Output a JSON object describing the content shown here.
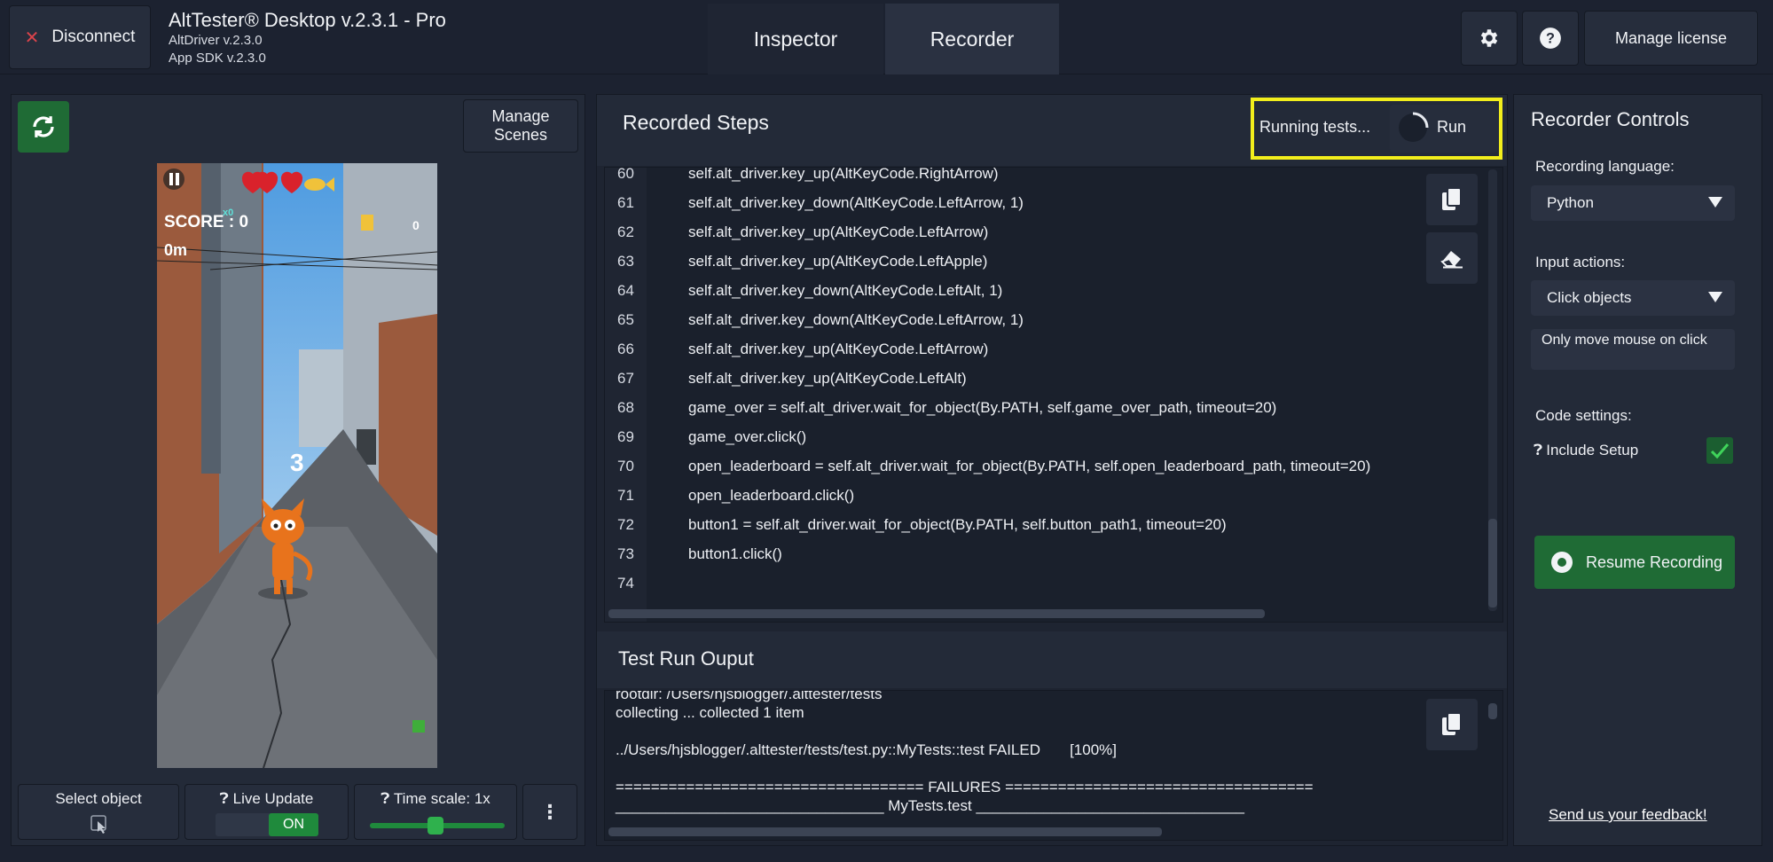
{
  "header": {
    "disconnect_label": "Disconnect",
    "app_title": "AltTester® Desktop v.2.3.1 - Pro",
    "altdriver_version": "AltDriver v.2.3.0",
    "app_sdk_version": "App SDK v.2.3.0",
    "tabs": [
      {
        "label": "Inspector",
        "active": false
      },
      {
        "label": "Recorder",
        "active": true
      }
    ],
    "manage_license_label": "Manage license"
  },
  "left_panel": {
    "manage_scenes_label": "Manage Scenes",
    "game_preview": {
      "score_label": "SCORE : 0",
      "distance_label": "0m",
      "multiplier_label": "x0",
      "countdown": "3",
      "side_count": "0",
      "hearts": 3
    },
    "bottom_controls": {
      "select_object_label": "Select object",
      "live_update_label": "Live Update",
      "live_update_state": "ON",
      "time_scale_label": "Time scale: 1x",
      "time_scale_value": 0.5
    }
  },
  "recorded_steps": {
    "title": "Recorded Steps",
    "running_text": "Running tests...",
    "run_label": "Run",
    "lines": [
      {
        "n": "60",
        "code": "self.alt_driver.key_up(AltKeyCode.RightArrow)"
      },
      {
        "n": "61",
        "code": "self.alt_driver.key_down(AltKeyCode.LeftArrow, 1)"
      },
      {
        "n": "62",
        "code": "self.alt_driver.key_up(AltKeyCode.LeftArrow)"
      },
      {
        "n": "63",
        "code": "self.alt_driver.key_up(AltKeyCode.LeftApple)"
      },
      {
        "n": "64",
        "code": "self.alt_driver.key_down(AltKeyCode.LeftAlt, 1)"
      },
      {
        "n": "65",
        "code": "self.alt_driver.key_down(AltKeyCode.LeftArrow, 1)"
      },
      {
        "n": "66",
        "code": "self.alt_driver.key_up(AltKeyCode.LeftArrow)"
      },
      {
        "n": "67",
        "code": "self.alt_driver.key_up(AltKeyCode.LeftAlt)"
      },
      {
        "n": "68",
        "code": "game_over = self.alt_driver.wait_for_object(By.PATH, self.game_over_path, timeout=20)"
      },
      {
        "n": "69",
        "code": "game_over.click()"
      },
      {
        "n": "70",
        "code": "open_leaderboard = self.alt_driver.wait_for_object(By.PATH, self.open_leaderboard_path, timeout=20)"
      },
      {
        "n": "71",
        "code": "open_leaderboard.click()"
      },
      {
        "n": "72",
        "code": "button1 = self.alt_driver.wait_for_object(By.PATH, self.button_path1, timeout=20)"
      },
      {
        "n": "73",
        "code": "button1.click()"
      },
      {
        "n": "74",
        "code": ""
      }
    ]
  },
  "test_output": {
    "title": "Test Run Ouput",
    "lines": [
      "rootdir: /Users/hjsblogger/.alttester/tests",
      "collecting ... collected 1 item",
      "",
      "../Users/hjsblogger/.alttester/tests/test.py::MyTests::test FAILED       [100%]",
      "",
      "=================================== FAILURES ===================================",
      "________________________________ MyTests.test ________________________________"
    ]
  },
  "recorder_controls": {
    "title": "Recorder Controls",
    "recording_language_label": "Recording language:",
    "recording_language_value": "Python",
    "input_actions_label": "Input actions:",
    "input_actions_value": "Click objects",
    "only_move_mouse_label": "Only move mouse on click",
    "code_settings_label": "Code settings:",
    "include_setup_label": "Include Setup",
    "include_setup_checked": true,
    "resume_recording_label": "Resume Recording",
    "feedback_label": "Send us your feedback!"
  },
  "colors": {
    "background": "#1c2230",
    "panel": "#232a38",
    "accent_green": "#1f6b35",
    "highlight_yellow": "#f2ee1c",
    "disconnect_red": "#d9434b"
  }
}
